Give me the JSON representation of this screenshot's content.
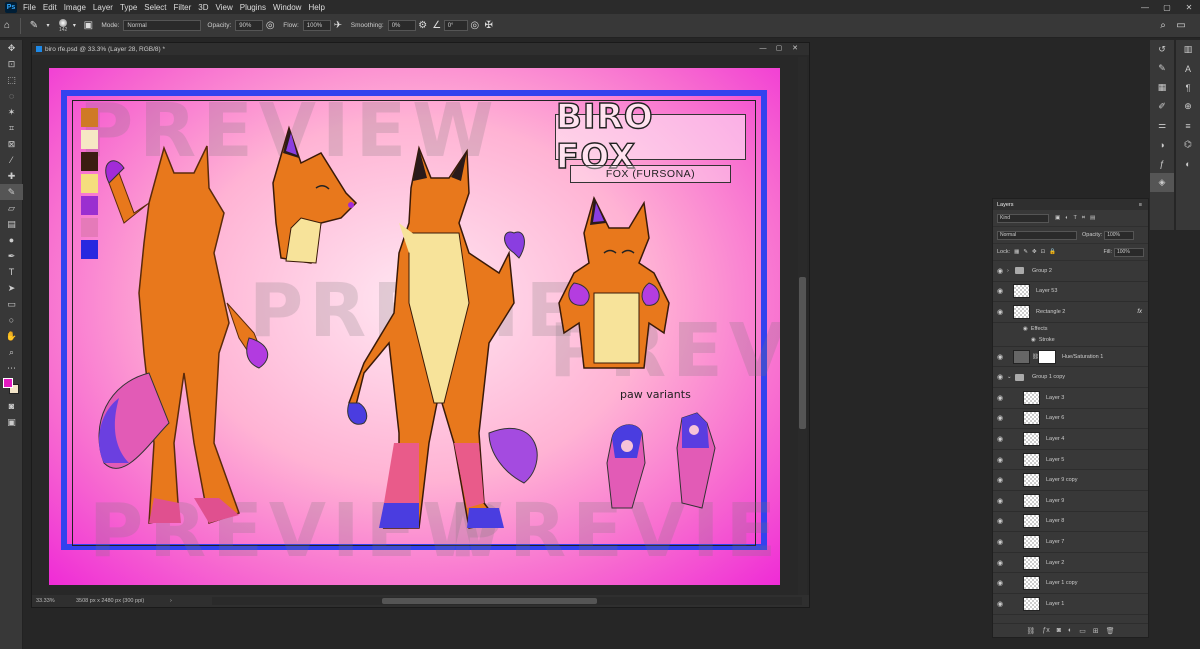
{
  "app": {
    "logo": "Ps"
  },
  "menu": [
    "File",
    "Edit",
    "Image",
    "Layer",
    "Type",
    "Select",
    "Filter",
    "3D",
    "View",
    "Plugins",
    "Window",
    "Help"
  ],
  "window_controls": [
    "—",
    "▢",
    "✕"
  ],
  "options_bar": {
    "brush_size": "142",
    "mode_label": "Mode:",
    "mode_value": "Normal",
    "opacity_label": "Opacity:",
    "opacity_value": "90%",
    "flow_label": "Flow:",
    "flow_value": "100%",
    "smoothing_label": "Smoothing:",
    "smoothing_value": "0%",
    "angle_value": "0°"
  },
  "document": {
    "tab_title": "biro rfe.psd @ 33.3% (Layer 28, RGB/8) *",
    "zoom": "33.33%",
    "doc_info": "3508 px x 2480 px (300 ppi)"
  },
  "artwork": {
    "title": "BIRO FOX",
    "subtitle": "FOX (FURSONA)",
    "paw_label": "paw variants",
    "watermark": "PREVIEW",
    "palette": [
      "#cf7a25",
      "#f6e7c4",
      "#3b1d12",
      "#f5dd7d",
      "#9b2fd0",
      "#e57ab9",
      "#2828e0"
    ]
  },
  "layers_panel": {
    "tab": "Layers",
    "filter_kind": "Kind",
    "blend_mode": "Normal",
    "opacity_label": "Opacity:",
    "opacity_value": "100%",
    "lock_label": "Lock:",
    "fill_label": "Fill:",
    "fill_value": "100%",
    "effects_label": "Effects",
    "stroke_label": "Stroke",
    "layers": [
      {
        "name": "Group 2",
        "kind": "group"
      },
      {
        "name": "Layer 53",
        "kind": "layer"
      },
      {
        "name": "Rectangle 2",
        "kind": "layer",
        "fx": "fx"
      },
      {
        "name": "Hue/Saturation 1",
        "kind": "adjustment"
      },
      {
        "name": "Group 1 copy",
        "kind": "group"
      },
      {
        "name": "Layer 3",
        "kind": "layer"
      },
      {
        "name": "Layer 6",
        "kind": "layer"
      },
      {
        "name": "Layer 4",
        "kind": "layer"
      },
      {
        "name": "Layer 5",
        "kind": "layer"
      },
      {
        "name": "Layer 9 copy",
        "kind": "layer"
      },
      {
        "name": "Layer 9",
        "kind": "layer"
      },
      {
        "name": "Layer 8",
        "kind": "layer"
      },
      {
        "name": "Layer 7",
        "kind": "layer"
      },
      {
        "name": "Layer 2",
        "kind": "layer"
      },
      {
        "name": "Layer 1 copy",
        "kind": "layer"
      },
      {
        "name": "Layer 1",
        "kind": "layer"
      }
    ]
  },
  "colors": {
    "foreground": "#e21ac0",
    "background": "#f3e5c8",
    "accent": "#31a8ff"
  }
}
